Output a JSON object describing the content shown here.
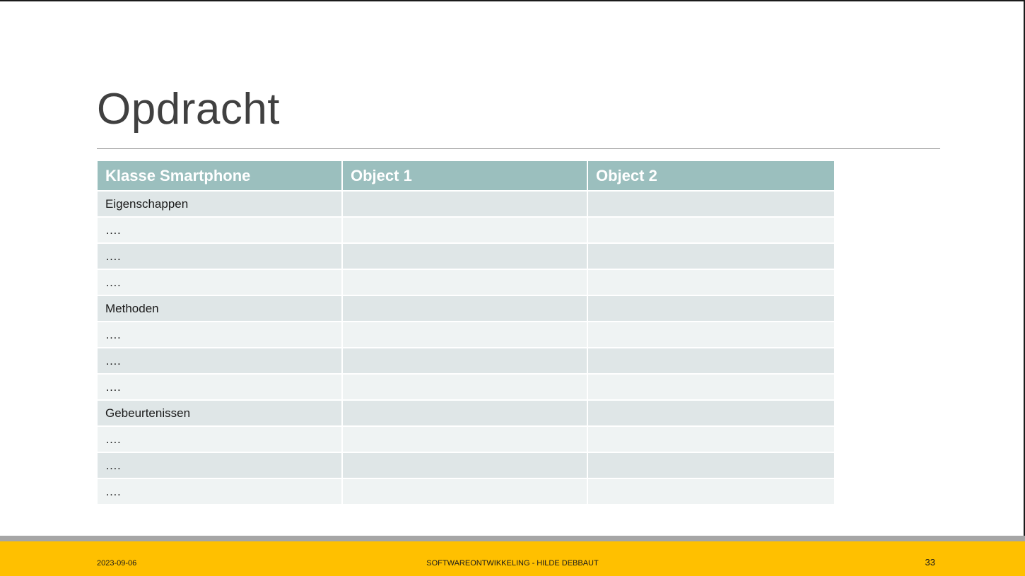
{
  "slide": {
    "title": "Opdracht",
    "table": {
      "headers": [
        "Klasse Smartphone",
        "Object 1",
        "Object 2"
      ],
      "rows": [
        [
          "Eigenschappen",
          "",
          ""
        ],
        [
          "….",
          "",
          ""
        ],
        [
          "….",
          "",
          ""
        ],
        [
          "….",
          "",
          ""
        ],
        [
          "Methoden",
          "",
          ""
        ],
        [
          "….",
          "",
          ""
        ],
        [
          "….",
          "",
          ""
        ],
        [
          "….",
          "",
          ""
        ],
        [
          "Gebeurtenissen",
          "",
          ""
        ],
        [
          "….",
          "",
          ""
        ],
        [
          "….",
          "",
          ""
        ],
        [
          "….",
          "",
          ""
        ]
      ]
    },
    "footer": {
      "date": "2023-09-06",
      "center": "SOFTWAREONTWIKKELING - HILDE DEBBAUT",
      "page": "33"
    }
  },
  "colors": {
    "header_bg": "#9bbfbe",
    "row_odd": "#dfe6e7",
    "row_even": "#eff3f3",
    "footer_band": "#ffc000",
    "footer_stripe": "#a6a6a6"
  }
}
